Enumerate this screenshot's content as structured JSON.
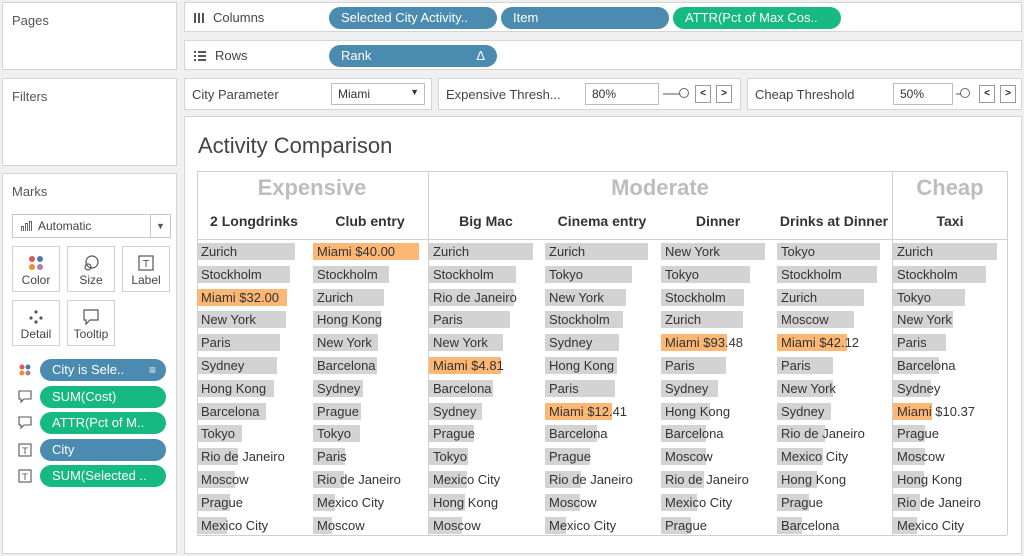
{
  "pages": {
    "title": "Pages"
  },
  "filters": {
    "title": "Filters"
  },
  "marks": {
    "title": "Marks",
    "type": "Automatic",
    "buttons": [
      "Color",
      "Size",
      "Label",
      "Detail",
      "Tooltip"
    ],
    "fields": [
      {
        "label": "City is Sele..",
        "color": "blue",
        "icon": "color-dots-icon"
      },
      {
        "label": "SUM(Cost)",
        "color": "green",
        "icon": "tooltip-icon"
      },
      {
        "label": "ATTR(Pct of M..",
        "color": "green",
        "icon": "tooltip-icon"
      },
      {
        "label": "City",
        "color": "blue",
        "icon": "label-icon"
      },
      {
        "label": "SUM(Selected ..",
        "color": "green",
        "icon": "label-icon"
      }
    ]
  },
  "columns": {
    "label": "Columns",
    "pills": [
      "Selected City Activity..",
      "Item",
      "ATTR(Pct of Max Cos.."
    ]
  },
  "rows": {
    "label": "Rows",
    "pills": [
      "Rank"
    ],
    "delta": "Δ"
  },
  "params": {
    "city": {
      "label": "City Parameter",
      "value": "Miami"
    },
    "expensive": {
      "label": "Expensive Thresh...",
      "value": "80%"
    },
    "cheap": {
      "label": "Cheap Threshold",
      "value": "50%"
    }
  },
  "colors": {
    "highlight": "#fcb774",
    "bar": "#d3d3d3",
    "pill_blue": "#4b8bb0",
    "pill_green": "#16b982"
  },
  "viz": {
    "title": "Activity Comparison",
    "groups": [
      "Expensive",
      "Moderate",
      "Cheap"
    ],
    "columns": [
      {
        "header": "2 Longdrinks",
        "group": "Expensive",
        "rows": [
          {
            "city": "Zurich",
            "pct": 0.92
          },
          {
            "city": "Stockholm",
            "pct": 0.88
          },
          {
            "city": "Miami",
            "pct": 0.85,
            "selected": true,
            "value": "$32.00"
          },
          {
            "city": "New York",
            "pct": 0.84
          },
          {
            "city": "Paris",
            "pct": 0.78
          },
          {
            "city": "Sydney",
            "pct": 0.75
          },
          {
            "city": "Hong Kong",
            "pct": 0.73
          },
          {
            "city": "Barcelona",
            "pct": 0.65
          },
          {
            "city": "Tokyo",
            "pct": 0.42
          },
          {
            "city": "Rio de Janeiro",
            "pct": 0.39
          },
          {
            "city": "Moscow",
            "pct": 0.36
          },
          {
            "city": "Prague",
            "pct": 0.31
          },
          {
            "city": "Mexico City",
            "pct": 0.28
          }
        ]
      },
      {
        "header": "Club entry",
        "group": "Expensive",
        "rows": [
          {
            "city": "Miami",
            "pct": 1.0,
            "selected": true,
            "value": "$40.00"
          },
          {
            "city": "Stockholm",
            "pct": 0.72
          },
          {
            "city": "Zurich",
            "pct": 0.67
          },
          {
            "city": "Hong Kong",
            "pct": 0.64
          },
          {
            "city": "New York",
            "pct": 0.61
          },
          {
            "city": "Barcelona",
            "pct": 0.6
          },
          {
            "city": "Sydney",
            "pct": 0.47
          },
          {
            "city": "Prague",
            "pct": 0.45
          },
          {
            "city": "Tokyo",
            "pct": 0.44
          },
          {
            "city": "Paris",
            "pct": 0.3
          },
          {
            "city": "Rio de Janeiro",
            "pct": 0.29
          },
          {
            "city": "Mexico City",
            "pct": 0.21
          },
          {
            "city": "Moscow",
            "pct": 0.18
          }
        ]
      },
      {
        "header": "Big Mac",
        "group": "Moderate",
        "rows": [
          {
            "city": "Zurich",
            "pct": 0.98
          },
          {
            "city": "Stockholm",
            "pct": 0.82
          },
          {
            "city": "Rio de Janeiro",
            "pct": 0.8
          },
          {
            "city": "Paris",
            "pct": 0.76
          },
          {
            "city": "New York",
            "pct": 0.7
          },
          {
            "city": "Miami",
            "pct": 0.68,
            "selected": true,
            "value": "$4.81"
          },
          {
            "city": "Barcelona",
            "pct": 0.6
          },
          {
            "city": "Sydney",
            "pct": 0.5
          },
          {
            "city": "Prague",
            "pct": 0.42
          },
          {
            "city": "Tokyo",
            "pct": 0.37
          },
          {
            "city": "Mexico City",
            "pct": 0.36
          },
          {
            "city": "Hong Kong",
            "pct": 0.34
          },
          {
            "city": "Moscow",
            "pct": 0.31
          }
        ]
      },
      {
        "header": "Cinema entry",
        "group": "Moderate",
        "rows": [
          {
            "city": "Zurich",
            "pct": 0.97
          },
          {
            "city": "Tokyo",
            "pct": 0.82
          },
          {
            "city": "New York",
            "pct": 0.76
          },
          {
            "city": "Stockholm",
            "pct": 0.74
          },
          {
            "city": "Sydney",
            "pct": 0.7
          },
          {
            "city": "Hong Kong",
            "pct": 0.68
          },
          {
            "city": "Paris",
            "pct": 0.66
          },
          {
            "city": "Miami",
            "pct": 0.63,
            "selected": true,
            "value": "$12.41"
          },
          {
            "city": "Barcelona",
            "pct": 0.49
          },
          {
            "city": "Prague",
            "pct": 0.42
          },
          {
            "city": "Rio de Janeiro",
            "pct": 0.34
          },
          {
            "city": "Moscow",
            "pct": 0.33
          },
          {
            "city": "Mexico City",
            "pct": 0.2
          }
        ]
      },
      {
        "header": "Dinner",
        "group": "Moderate",
        "rows": [
          {
            "city": "New York",
            "pct": 0.98
          },
          {
            "city": "Tokyo",
            "pct": 0.84
          },
          {
            "city": "Stockholm",
            "pct": 0.78
          },
          {
            "city": "Zurich",
            "pct": 0.77
          },
          {
            "city": "Miami",
            "pct": 0.62,
            "selected": true,
            "value": "$93.48"
          },
          {
            "city": "Paris",
            "pct": 0.61
          },
          {
            "city": "Sydney",
            "pct": 0.54
          },
          {
            "city": "Hong Kong",
            "pct": 0.46
          },
          {
            "city": "Barcelona",
            "pct": 0.42
          },
          {
            "city": "Moscow",
            "pct": 0.42
          },
          {
            "city": "Rio de Janeiro",
            "pct": 0.41
          },
          {
            "city": "Mexico City",
            "pct": 0.34
          },
          {
            "city": "Prague",
            "pct": 0.28
          }
        ]
      },
      {
        "header": "Drinks at Dinner",
        "group": "Moderate",
        "rows": [
          {
            "city": "Tokyo",
            "pct": 0.97
          },
          {
            "city": "Stockholm",
            "pct": 0.94
          },
          {
            "city": "Zurich",
            "pct": 0.82
          },
          {
            "city": "Moscow",
            "pct": 0.73
          },
          {
            "city": "Miami",
            "pct": 0.66,
            "selected": true,
            "value": "$42.12"
          },
          {
            "city": "Paris",
            "pct": 0.53
          },
          {
            "city": "New York",
            "pct": 0.53
          },
          {
            "city": "Sydney",
            "pct": 0.51
          },
          {
            "city": "Rio de Janeiro",
            "pct": 0.45
          },
          {
            "city": "Mexico City",
            "pct": 0.43
          },
          {
            "city": "Hong Kong",
            "pct": 0.38
          },
          {
            "city": "Prague",
            "pct": 0.3
          },
          {
            "city": "Barcelona",
            "pct": 0.24
          }
        ]
      },
      {
        "header": "Taxi",
        "group": "Cheap",
        "rows": [
          {
            "city": "Zurich",
            "pct": 0.98
          },
          {
            "city": "Stockholm",
            "pct": 0.88
          },
          {
            "city": "Tokyo",
            "pct": 0.68
          },
          {
            "city": "New York",
            "pct": 0.57
          },
          {
            "city": "Paris",
            "pct": 0.5
          },
          {
            "city": "Barcelona",
            "pct": 0.43
          },
          {
            "city": "Sydney",
            "pct": 0.36
          },
          {
            "city": "Miami",
            "pct": 0.37,
            "selected": true,
            "value": "$10.37"
          },
          {
            "city": "Prague",
            "pct": 0.3
          },
          {
            "city": "Moscow",
            "pct": 0.3
          },
          {
            "city": "Hong Kong",
            "pct": 0.29
          },
          {
            "city": "Rio de Janeiro",
            "pct": 0.25
          },
          {
            "city": "Mexico City",
            "pct": 0.23
          }
        ]
      }
    ]
  }
}
